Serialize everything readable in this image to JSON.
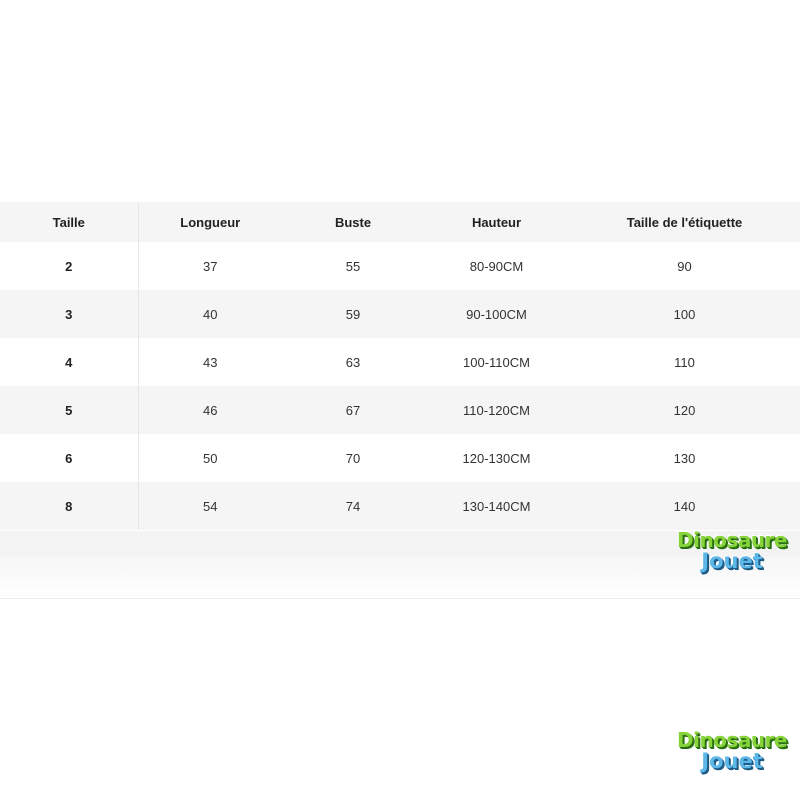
{
  "table": {
    "headers": [
      "Taille",
      "Longueur",
      "Buste",
      "Hauteur",
      "Taille de l'étiquette"
    ],
    "rows": [
      [
        "2",
        "37",
        "55",
        "80-90CM",
        "90"
      ],
      [
        "3",
        "40",
        "59",
        "90-100CM",
        "100"
      ],
      [
        "4",
        "43",
        "63",
        "100-110CM",
        "110"
      ],
      [
        "5",
        "46",
        "67",
        "110-120CM",
        "120"
      ],
      [
        "6",
        "50",
        "70",
        "120-130CM",
        "130"
      ],
      [
        "8",
        "54",
        "74",
        "130-140CM",
        "140"
      ]
    ]
  },
  "watermark": {
    "line1": "Dinosaure",
    "line2": "Jouet",
    "colors": {
      "line1": "#86d43a",
      "line2": "#5db7e8"
    }
  }
}
